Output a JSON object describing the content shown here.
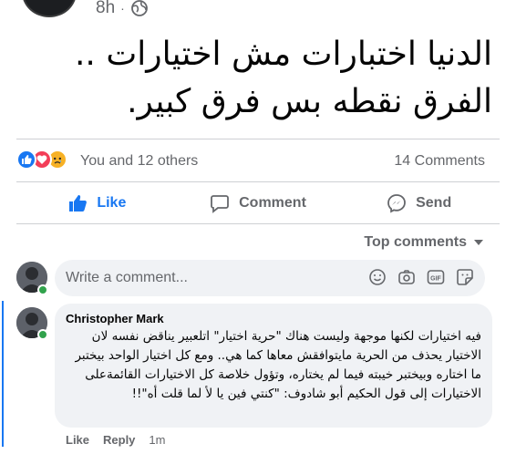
{
  "post": {
    "time": "8h",
    "separator": "·",
    "privacy_icon": "globe-icon",
    "text_line1": "الدنيا اختبارات مش اختيارات ..",
    "text_line2": "الفرق نقطه بس فرق كبير."
  },
  "reactions": {
    "icons": [
      "like-icon",
      "love-icon",
      "sad-icon"
    ],
    "summary": "You and 12 others",
    "comments_count": "14 Comments"
  },
  "actions": {
    "like": "Like",
    "comment": "Comment",
    "send": "Send"
  },
  "comments_sort": {
    "label": "Top comments"
  },
  "composer": {
    "placeholder": "Write a comment...",
    "icons": [
      "emoji-icon",
      "camera-icon",
      "gif-icon",
      "sticker-icon"
    ]
  },
  "comment": {
    "author": "Christopher Mark",
    "text": "فيه اختيارات لكنها موجهة وليست هناك \"حرية اختيار\" اتلعبير يناقض نفسه لان الاختيار يحذف من الحرية مايتوافقش معاها كما هي.. ومع كل اختيار الواحد بيختبر ما اختاره وبيختبر خيبته فيما لم يختاره، وتؤول خلاصة كل الاختيارات القائمةعلى الاختيارات إلى قول الحكيم أبو شادوف: \"كنتي فين يا لأ لما قلت أه\"!!",
    "like_label": "Like",
    "reply_label": "Reply",
    "time": "1m"
  },
  "colors": {
    "accent": "#1877f2",
    "muted": "#65676b",
    "bubble": "#f0f2f5",
    "online": "#31a24c"
  }
}
